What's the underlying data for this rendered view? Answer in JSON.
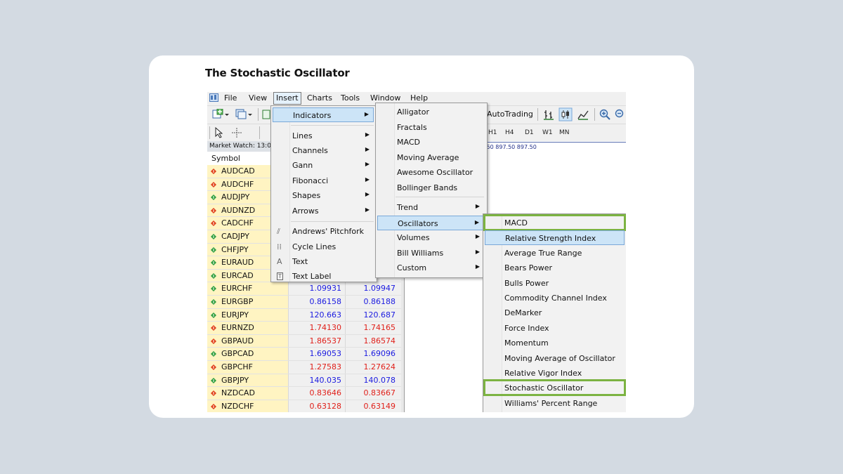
{
  "page": {
    "title": "The Stochastic Oscillator"
  },
  "menubar": {
    "items": [
      "File",
      "View",
      "Insert",
      "Charts",
      "Tools",
      "Window",
      "Help"
    ],
    "active": "Insert"
  },
  "toolbar": {
    "autotrading_label": "AutoTrading",
    "timeframes": [
      "H1",
      "H4",
      "D1",
      "W1",
      "MN"
    ]
  },
  "chart": {
    "price_text": ".50 897.50 897.50"
  },
  "market_watch": {
    "header": "Market Watch: 13:0",
    "column_symbol": "Symbol",
    "rows": [
      {
        "symbol": "AUDCAD",
        "dir": "down",
        "bid": "",
        "ask": "",
        "color": "blue"
      },
      {
        "symbol": "AUDCHF",
        "dir": "down",
        "bid": "",
        "ask": "",
        "color": "blue"
      },
      {
        "symbol": "AUDJPY",
        "dir": "up",
        "bid": "",
        "ask": "",
        "color": "blue"
      },
      {
        "symbol": "AUDNZD",
        "dir": "down",
        "bid": "",
        "ask": "",
        "color": "blue"
      },
      {
        "symbol": "CADCHF",
        "dir": "down",
        "bid": "",
        "ask": "",
        "color": "blue"
      },
      {
        "symbol": "CADJPY",
        "dir": "up",
        "bid": "",
        "ask": "",
        "color": "blue"
      },
      {
        "symbol": "CHFJPY",
        "dir": "up",
        "bid": "",
        "ask": "",
        "color": "blue"
      },
      {
        "symbol": "EURAUD",
        "dir": "up",
        "bid": "",
        "ask": "",
        "color": "blue"
      },
      {
        "symbol": "EURCAD",
        "dir": "up",
        "bid": "",
        "ask": "5883",
        "color": "blue"
      },
      {
        "symbol": "EURCHF",
        "dir": "up",
        "bid": "1.09931",
        "ask": "1.09947",
        "color": "blue"
      },
      {
        "symbol": "EURGBP",
        "dir": "up",
        "bid": "0.86158",
        "ask": "0.86188",
        "color": "blue"
      },
      {
        "symbol": "EURJPY",
        "dir": "up",
        "bid": "120.663",
        "ask": "120.687",
        "color": "blue"
      },
      {
        "symbol": "EURNZD",
        "dir": "down",
        "bid": "1.74130",
        "ask": "1.74165",
        "color": "red"
      },
      {
        "symbol": "GBPAUD",
        "dir": "down",
        "bid": "1.86537",
        "ask": "1.86574",
        "color": "red"
      },
      {
        "symbol": "GBPCAD",
        "dir": "up",
        "bid": "1.69053",
        "ask": "1.69096",
        "color": "blue"
      },
      {
        "symbol": "GBPCHF",
        "dir": "down",
        "bid": "1.27583",
        "ask": "1.27624",
        "color": "red"
      },
      {
        "symbol": "GBPJPY",
        "dir": "up",
        "bid": "140.035",
        "ask": "140.078",
        "color": "blue"
      },
      {
        "symbol": "NZDCAD",
        "dir": "down",
        "bid": "0.83646",
        "ask": "0.83667",
        "color": "red"
      },
      {
        "symbol": "NZDCHF",
        "dir": "down",
        "bid": "0.63128",
        "ask": "0.63149",
        "color": "red"
      }
    ]
  },
  "insert_menu": {
    "indicators": "Indicators",
    "lines": "Lines",
    "channels": "Channels",
    "gann": "Gann",
    "fibonacci": "Fibonacci",
    "shapes": "Shapes",
    "arrows": "Arrows",
    "pitchfork": "Andrews' Pitchfork",
    "cycle_lines": "Cycle Lines",
    "text": "Text",
    "text_label": "Text Label"
  },
  "indicators_menu": {
    "top": [
      "Alligator",
      "Fractals",
      "MACD",
      "Moving Average",
      "Awesome Oscillator",
      "Bollinger Bands"
    ],
    "groups": [
      "Trend",
      "Oscillators",
      "Volumes",
      "Bill Williams",
      "Custom"
    ],
    "highlighted": "Oscillators"
  },
  "oscillators_menu": {
    "items": [
      "MACD",
      "Relative Strength Index",
      "Average True Range",
      "Bears Power",
      "Bulls Power",
      "Commodity Channel Index",
      "DeMarker",
      "Force Index",
      "Momentum",
      "Moving Average of Oscillator",
      "Relative Vigor Index",
      "Stochastic Oscillator",
      "Williams' Percent Range"
    ],
    "highlighted": "Relative Strength Index",
    "outlined": [
      "MACD",
      "Stochastic Oscillator"
    ]
  }
}
